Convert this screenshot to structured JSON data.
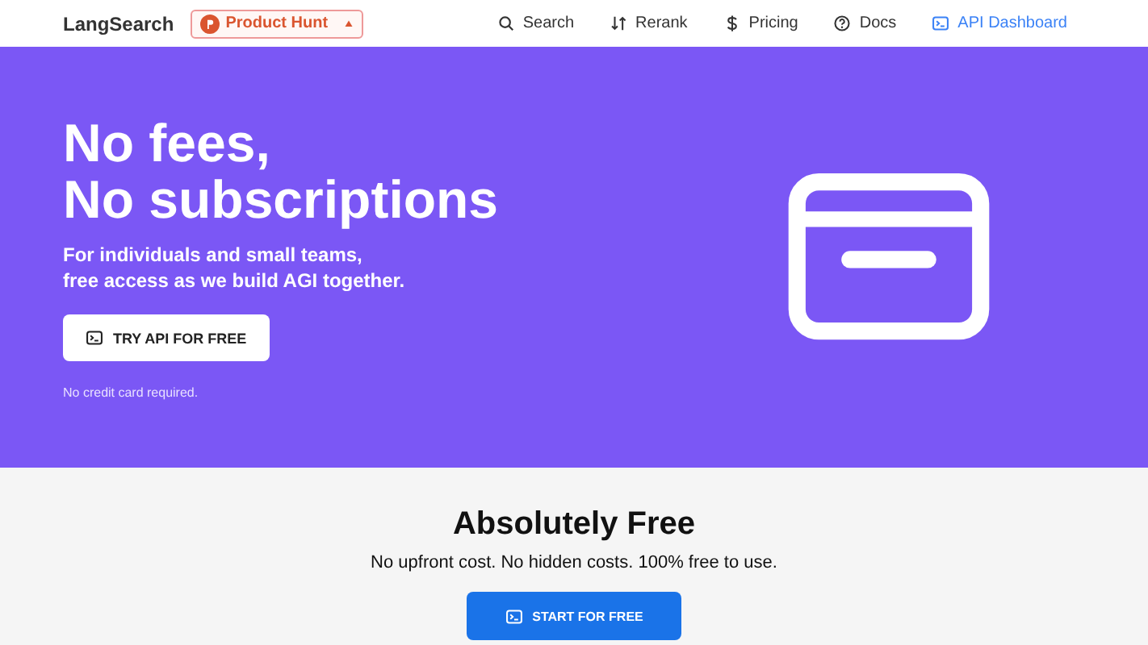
{
  "header": {
    "logo": "LangSearch",
    "badge": "Product Hunt",
    "nav": [
      {
        "label": "Search",
        "selected": false
      },
      {
        "label": "Rerank",
        "selected": false
      },
      {
        "label": "Pricing",
        "selected": false
      },
      {
        "label": "Docs",
        "selected": false
      },
      {
        "label": "API Dashboard",
        "selected": true
      }
    ]
  },
  "hero": {
    "title": [
      "No fees,",
      "No subscriptions"
    ],
    "subtitle": [
      "For individuals and small teams,",
      "free access as we build AGI together."
    ],
    "button": "TRY API FOR FREE",
    "note": "No credit card required."
  },
  "free": {
    "title": "Absolutely Free",
    "text": "No upfront cost. No hidden costs. 100% free to use.",
    "button": "START FOR FREE"
  }
}
